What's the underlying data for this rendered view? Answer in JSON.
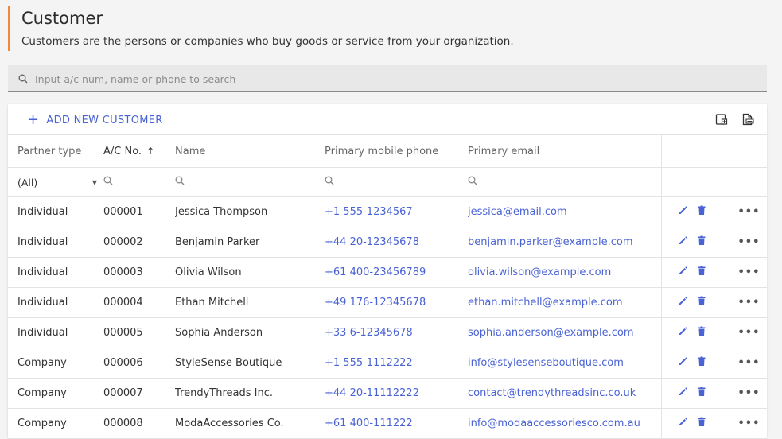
{
  "page": {
    "title": "Customer",
    "subtitle": "Customers are the persons or companies who buy goods or service from your organization."
  },
  "search": {
    "placeholder": "Input a/c num, name or phone to search"
  },
  "toolbar": {
    "add_label": "ADD NEW CUSTOMER"
  },
  "columns": {
    "partner_type": "Partner type",
    "ac_no": "A/C No.",
    "name": "Name",
    "phone": "Primary mobile phone",
    "email": "Primary email"
  },
  "filters": {
    "partner_type": "(All)"
  },
  "colors": {
    "accent": "#4a63d4",
    "header_bar": "#f0893c"
  },
  "rows": [
    {
      "type": "Individual",
      "ac": "000001",
      "name": "Jessica Thompson",
      "phone": "+1 555-1234567",
      "email": "jessica@email.com"
    },
    {
      "type": "Individual",
      "ac": "000002",
      "name": "Benjamin Parker",
      "phone": "+44 20-12345678",
      "email": "benjamin.parker@example.com"
    },
    {
      "type": "Individual",
      "ac": "000003",
      "name": "Olivia Wilson",
      "phone": "+61 400-23456789",
      "email": "olivia.wilson@example.com"
    },
    {
      "type": "Individual",
      "ac": "000004",
      "name": "Ethan Mitchell",
      "phone": "+49 176-12345678",
      "email": "ethan.mitchell@example.com"
    },
    {
      "type": "Individual",
      "ac": "000005",
      "name": "Sophia Anderson",
      "phone": "+33 6-12345678",
      "email": "sophia.anderson@example.com"
    },
    {
      "type": "Company",
      "ac": "000006",
      "name": "StyleSense Boutique",
      "phone": "+1 555-1112222",
      "email": "info@stylesenseboutique.com"
    },
    {
      "type": "Company",
      "ac": "000007",
      "name": "TrendyThreads Inc.",
      "phone": "+44 20-11112222",
      "email": "contact@trendythreadsinc.co.uk"
    },
    {
      "type": "Company",
      "ac": "000008",
      "name": "ModaAccessories Co.",
      "phone": "+61 400-111222",
      "email": "info@modaaccessoriesco.com.au"
    }
  ]
}
